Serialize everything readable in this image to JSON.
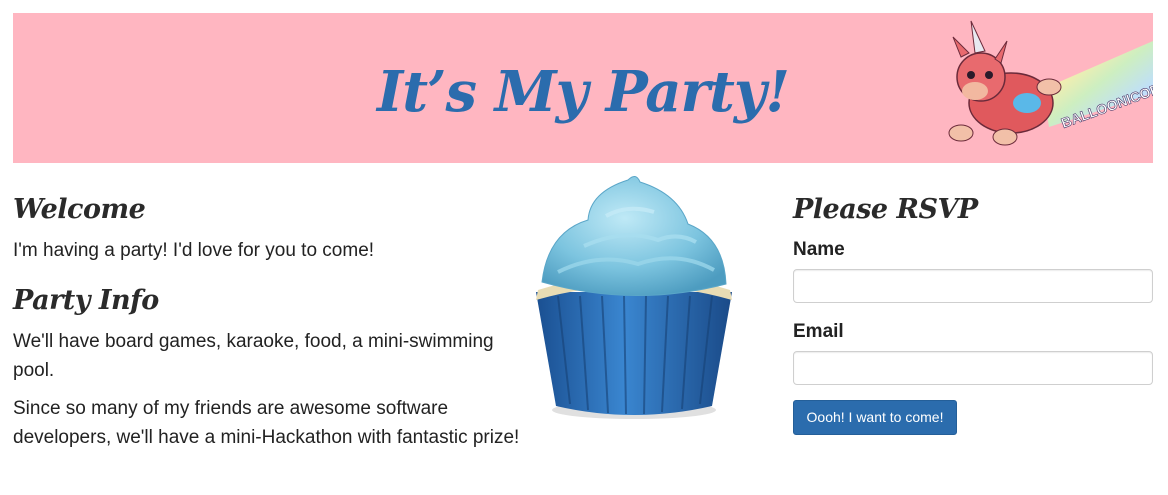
{
  "banner": {
    "title": "It’s My Party!",
    "background": "#ffb6c1",
    "title_color": "#2b6cad",
    "mascot_label": "BALLOONICORN",
    "mascot_icon": "unicorn-balloon-icon"
  },
  "welcome": {
    "heading": "Welcome",
    "text": "I'm having a party! I'd love for you to come!"
  },
  "party_info": {
    "heading": "Party Info",
    "paragraph1": "We'll have board games, karaoke, food, a mini-swimming pool.",
    "paragraph2": "Since so many of my friends are awesome software developers, we'll have a mini-Hackathon with fantastic prize!"
  },
  "cupcake": {
    "icon": "cupcake-icon",
    "frosting_color": "#7fc8e0",
    "wrapper_color": "#2a67b0"
  },
  "rsvp": {
    "heading": "Please RSVP",
    "name_label": "Name",
    "name_value": "",
    "email_label": "Email",
    "email_value": "",
    "submit_label": "Oooh! I want to come!",
    "button_color": "#2b6cad"
  }
}
